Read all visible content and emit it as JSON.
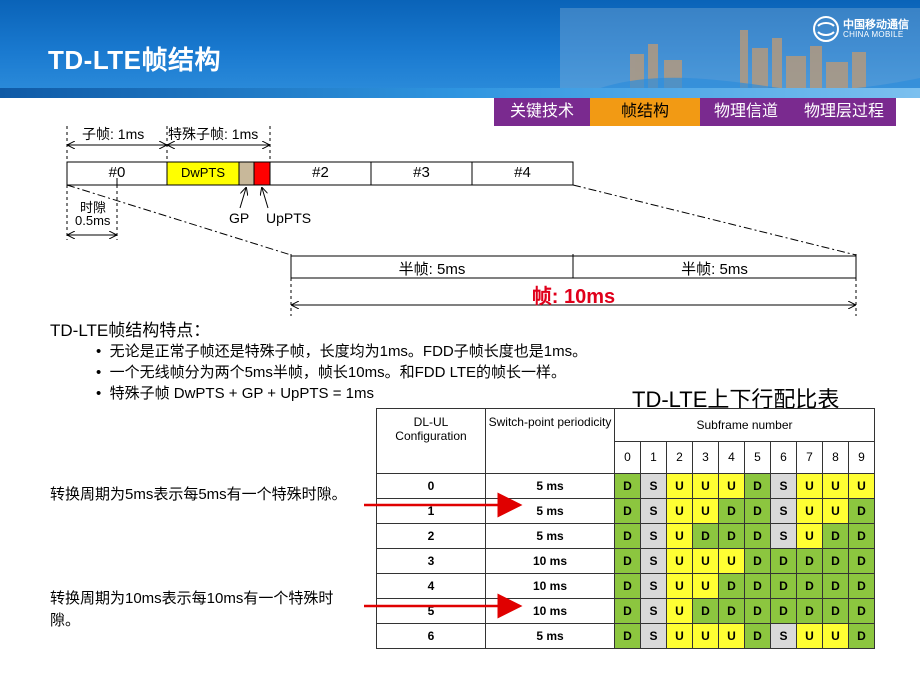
{
  "header": {
    "title": "TD-LTE帧结构",
    "logo_cn": "中国移动通信",
    "logo_en": "CHINA MOBILE"
  },
  "tabs": [
    {
      "label": "关键技术"
    },
    {
      "label": "帧结构"
    },
    {
      "label": "物理信道"
    },
    {
      "label": "物理层过程"
    }
  ],
  "frame_diagram": {
    "subframe_label": "子帧: 1ms",
    "special_subframe_label": "特殊子帧: 1ms",
    "subframes": [
      "#0",
      "DwPTS",
      "#2",
      "#3",
      "#4"
    ],
    "gp_label": "GP",
    "uppts_label": "UpPTS",
    "slot_label_1": "时隙",
    "slot_label_2": "0.5ms",
    "half_frame_1": "半帧: 5ms",
    "half_frame_2": "半帧: 5ms",
    "frame_label": "帧: 10ms"
  },
  "features": {
    "title": "TD-LTE帧结构特点：",
    "bullets": [
      "无论是正常子帧还是特殊子帧，长度均为1ms。FDD子帧长度也是1ms。",
      "一个无线帧分为两个5ms半帧，帧长10ms。和FDD LTE的帧长一样。",
      "特殊子帧 DwPTS + GP + UpPTS = 1ms"
    ]
  },
  "notes": {
    "note1": "转换周期为5ms表示每5ms有一个特殊时隙。",
    "note2": "转换周期为10ms表示每10ms有一个特殊时隙。"
  },
  "table": {
    "title": "TD-LTE上下行配比表",
    "col_config": "DL-UL Configuration",
    "col_period": "Switch-point periodicity",
    "col_subframe": "Subframe number",
    "subframe_numbers": [
      "0",
      "1",
      "2",
      "3",
      "4",
      "5",
      "6",
      "7",
      "8",
      "9"
    ],
    "rows": [
      {
        "config": "0",
        "period": "5 ms",
        "sf": [
          "D",
          "S",
          "U",
          "U",
          "U",
          "D",
          "S",
          "U",
          "U",
          "U"
        ]
      },
      {
        "config": "1",
        "period": "5 ms",
        "sf": [
          "D",
          "S",
          "U",
          "U",
          "D",
          "D",
          "S",
          "U",
          "U",
          "D"
        ]
      },
      {
        "config": "2",
        "period": "5 ms",
        "sf": [
          "D",
          "S",
          "U",
          "D",
          "D",
          "D",
          "S",
          "U",
          "D",
          "D"
        ]
      },
      {
        "config": "3",
        "period": "10 ms",
        "sf": [
          "D",
          "S",
          "U",
          "U",
          "U",
          "D",
          "D",
          "D",
          "D",
          "D"
        ]
      },
      {
        "config": "4",
        "period": "10 ms",
        "sf": [
          "D",
          "S",
          "U",
          "U",
          "D",
          "D",
          "D",
          "D",
          "D",
          "D"
        ]
      },
      {
        "config": "5",
        "period": "10 ms",
        "sf": [
          "D",
          "S",
          "U",
          "D",
          "D",
          "D",
          "D",
          "D",
          "D",
          "D"
        ]
      },
      {
        "config": "6",
        "period": "5 ms",
        "sf": [
          "D",
          "S",
          "U",
          "U",
          "U",
          "D",
          "S",
          "U",
          "U",
          "D"
        ]
      }
    ],
    "colors": {
      "D": "#8cc63f",
      "S": "#d9d9d9",
      "U": "#ffff33"
    }
  },
  "colors": {
    "header_blue": "#1a7ad0",
    "tab_purple": "#7a2a8f",
    "tab_active": "#f29a14",
    "frame_red": "#e0001b",
    "arrow_red": "#e00000",
    "dwpts_yellow": "#ffff00",
    "gp_tan": "#c8b89a",
    "uppts_red": "#ff0000"
  }
}
